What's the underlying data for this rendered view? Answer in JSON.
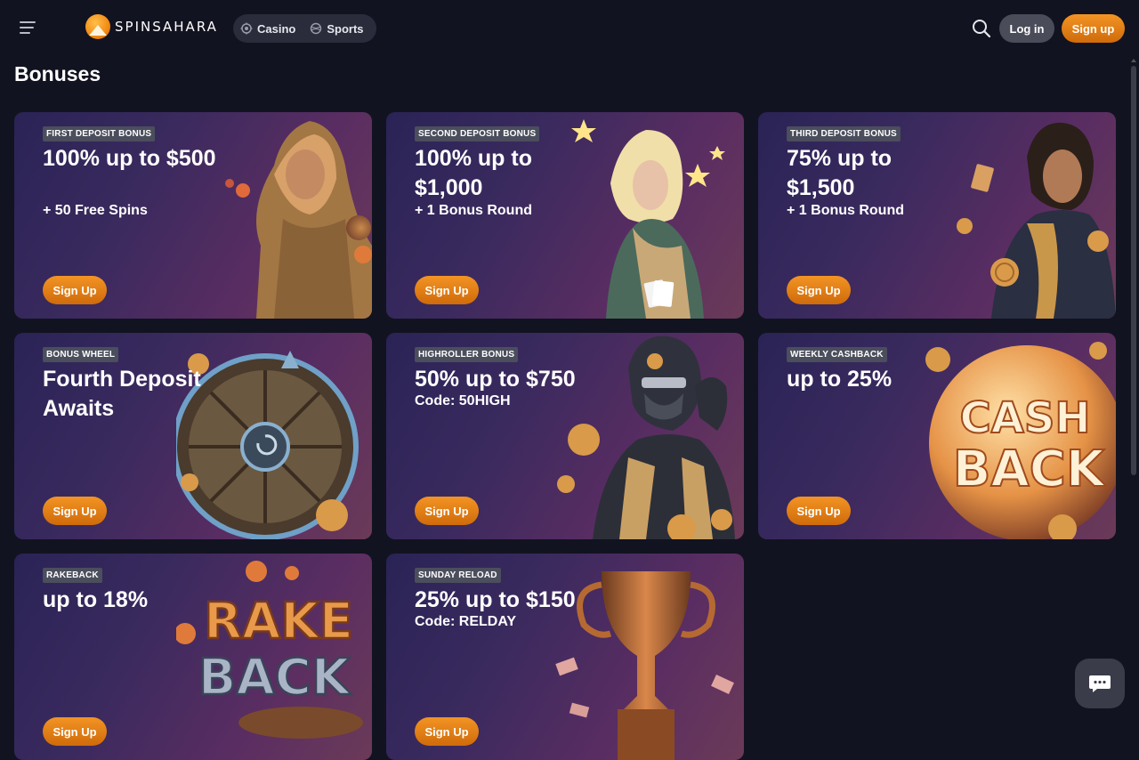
{
  "header": {
    "logo_text": "SPINSAHARA",
    "nav": [
      {
        "label": "Casino",
        "icon": "casino-chip-icon"
      },
      {
        "label": "Sports",
        "icon": "sports-ball-icon"
      }
    ],
    "login_label": "Log in",
    "signup_label": "Sign up",
    "search_icon": "search-icon",
    "menu_icon": "hamburger-menu-icon"
  },
  "page": {
    "title": "Bonuses"
  },
  "colors": {
    "background": "#121320",
    "accent": "#e67e16",
    "tag_bg": "#4b4e5c"
  },
  "cards": [
    {
      "tag": "FIRST DEPOSIT BONUS",
      "headline": "100% up to $500",
      "subline": "+ 50 Free Spins",
      "button": "Sign Up",
      "art": "desert-woman"
    },
    {
      "tag": "SECOND DEPOSIT BONUS",
      "headline": "100% up to $1,000",
      "subline": "+ 1 Bonus Round",
      "button": "Sign Up",
      "art": "blonde-woman-cards"
    },
    {
      "tag": "THIRD DEPOSIT BONUS",
      "headline": "75% up to $1,500",
      "subline": "+ 1 Bonus Round",
      "button": "Sign Up",
      "art": "man-coins"
    },
    {
      "tag": "BONUS WHEEL",
      "headline": "Fourth Deposit Awaits",
      "subline": "",
      "button": "Sign Up",
      "art": "bonus-wheel"
    },
    {
      "tag": "HIGHROLLER BONUS",
      "headline": "50% up to $750",
      "subline": "Code: 50HIGH",
      "button": "Sign Up",
      "art": "ninja"
    },
    {
      "tag": "WEEKLY CASHBACK",
      "headline": "up to 25%",
      "subline": "",
      "button": "Sign Up",
      "art": "cashback-orb"
    },
    {
      "tag": "RAKEBACK",
      "headline": "up to 18%",
      "subline": "",
      "button": "Sign Up",
      "art": "rakeback-text"
    },
    {
      "tag": "SUNDAY RELOAD",
      "headline": "25% up to $150",
      "subline": "Code: RELDAY",
      "button": "Sign Up",
      "art": "trophy"
    }
  ],
  "chat": {
    "icon": "chat-bubble-icon"
  }
}
